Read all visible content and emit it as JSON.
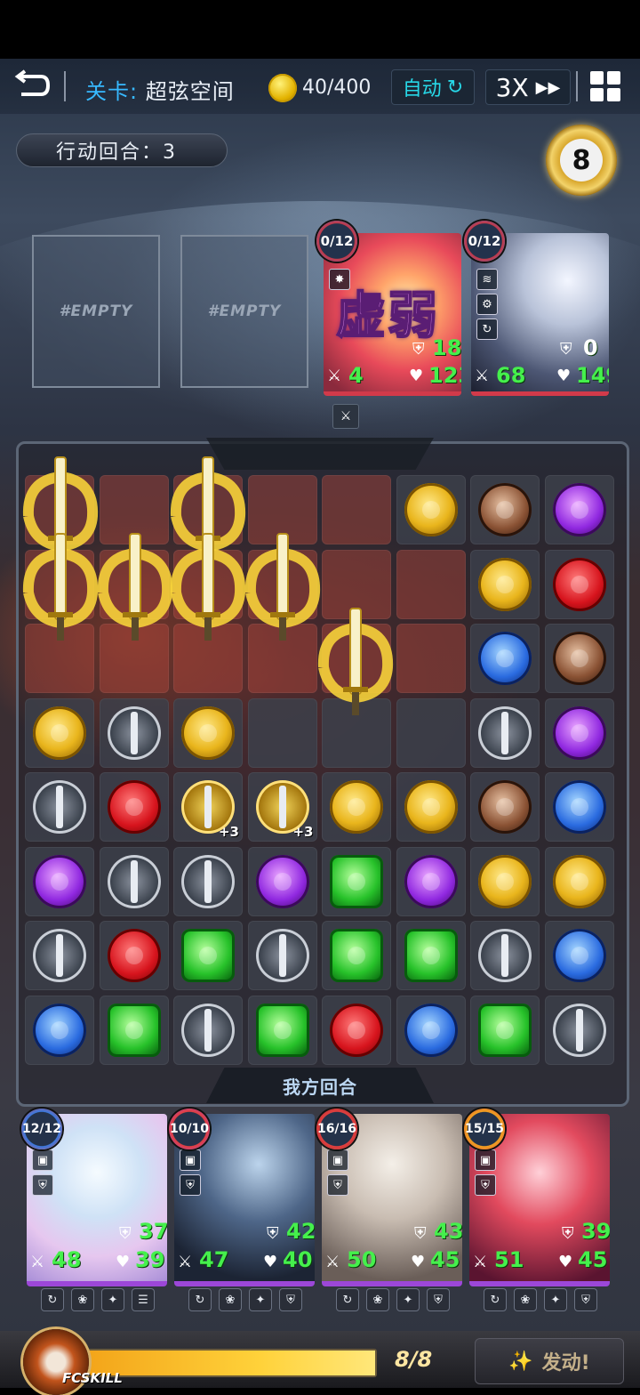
{
  "hud": {
    "stage_label": "关卡:",
    "stage_name": "超弦空间",
    "coins": "40/400",
    "auto_label": "自动",
    "speed_label": "3X"
  },
  "turn": {
    "label": "行动回合：3"
  },
  "timer": {
    "value": "8"
  },
  "empty_slots": [
    "#EMPTY",
    "#EMPTY"
  ],
  "enemies": [
    {
      "charge": "0/12",
      "status": "虚弱",
      "shield": "18",
      "attack": "4",
      "hp": "123"
    },
    {
      "charge": "0/12",
      "shield": "0",
      "attack": "68",
      "hp": "149"
    }
  ],
  "board": {
    "footer_label": "我方回合",
    "grid": [
      [
        "hot",
        "hot",
        "hot",
        "hot",
        "hot",
        "gold",
        "brown",
        "purple"
      ],
      [
        "hot",
        "hot",
        "hot",
        "hot",
        "hot",
        "hot",
        "gold",
        "red"
      ],
      [
        "hot",
        "hot",
        "hot",
        "hot",
        "hot",
        "hot",
        "blue",
        "brown"
      ],
      [
        "gold",
        "sword",
        "gold",
        "empty",
        "empty",
        "empty",
        "sword",
        "purple"
      ],
      [
        "sword",
        "red",
        "gsword",
        "gsword",
        "gold",
        "gold",
        "brown",
        "blue"
      ],
      [
        "purple",
        "sword",
        "sword",
        "purple",
        "green",
        "purple",
        "gold",
        "gold"
      ],
      [
        "sword",
        "red",
        "green",
        "sword",
        "green",
        "green",
        "sword",
        "blue"
      ],
      [
        "blue",
        "green",
        "sword",
        "green",
        "red",
        "blue",
        "green",
        "sword"
      ]
    ],
    "bonus": "+3"
  },
  "heroes": [
    {
      "charge": "12/12",
      "shield": "37",
      "attack": "48",
      "hp": "39"
    },
    {
      "charge": "10/10",
      "shield": "42",
      "attack": "47",
      "hp": "40"
    },
    {
      "charge": "16/16",
      "shield": "43",
      "attack": "50",
      "hp": "45"
    },
    {
      "charge": "15/15",
      "shield": "39",
      "attack": "51",
      "hp": "45"
    }
  ],
  "fcskill": {
    "label": "FCSKILL",
    "energy": "8/8",
    "energy_fraction": 1.0,
    "launch_label": "发动!"
  }
}
